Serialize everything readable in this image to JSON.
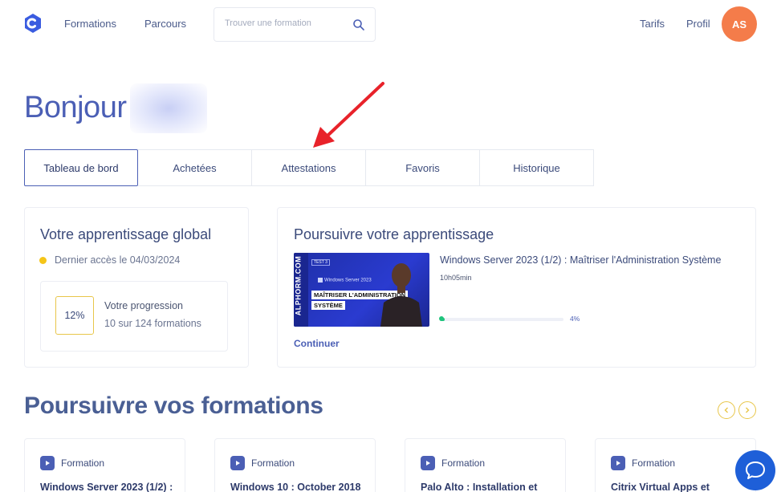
{
  "header": {
    "nav": [
      "Formations",
      "Parcours"
    ],
    "search_placeholder": "Trouver une formation",
    "right_links": [
      "Tarifs",
      "Profil"
    ],
    "avatar_initials": "AS",
    "avatar_color": "#f47c4a"
  },
  "greeting": "Bonjour",
  "tabs": [
    "Tableau de bord",
    "Achetées",
    "Attestations",
    "Favoris",
    "Historique"
  ],
  "active_tab": "Tableau de bord",
  "global_card": {
    "title": "Votre apprentissage global",
    "last_access": "Dernier accès le 04/03/2024",
    "progress_pct": "12%",
    "progress_label": "Votre progression",
    "progress_count": "10 sur 124 formations"
  },
  "continue_card": {
    "title": "Poursuivre votre apprentissage",
    "thumbnail": {
      "brand": "ALPHORM.COM",
      "tag": "TEST 3",
      "product": "Windows Server 2023",
      "line1": "MAÎTRISER L'ADMINISTRATION",
      "line2": "SYSTÈME"
    },
    "course_title": "Windows Server 2023 (1/2) : Maîtriser l'Administration Système",
    "duration": "10h05min",
    "progress": 0.04,
    "progress_text": "4%",
    "continue_label": "Continuer"
  },
  "section_title": "Poursuivre vos formations",
  "formations": [
    {
      "badge": "Formation",
      "title": "Windows Server 2023 (1/2) :"
    },
    {
      "badge": "Formation",
      "title": "Windows 10 : October 2018"
    },
    {
      "badge": "Formation",
      "title": "Palo Alto : Installation et"
    },
    {
      "badge": "Formation",
      "title": "Citrix Virtual Apps et"
    }
  ],
  "colors": {
    "accent": "#4b5fb5",
    "progress_green": "#1fc47c",
    "highlight_yellow": "#e8c64a",
    "annotation_arrow": "#e8222a"
  },
  "icons": [
    "logo-icon",
    "search-icon",
    "clock-dot-icon",
    "play-icon",
    "chevron-left-icon",
    "chevron-right-icon",
    "chat-icon",
    "annotation-arrow-icon"
  ]
}
